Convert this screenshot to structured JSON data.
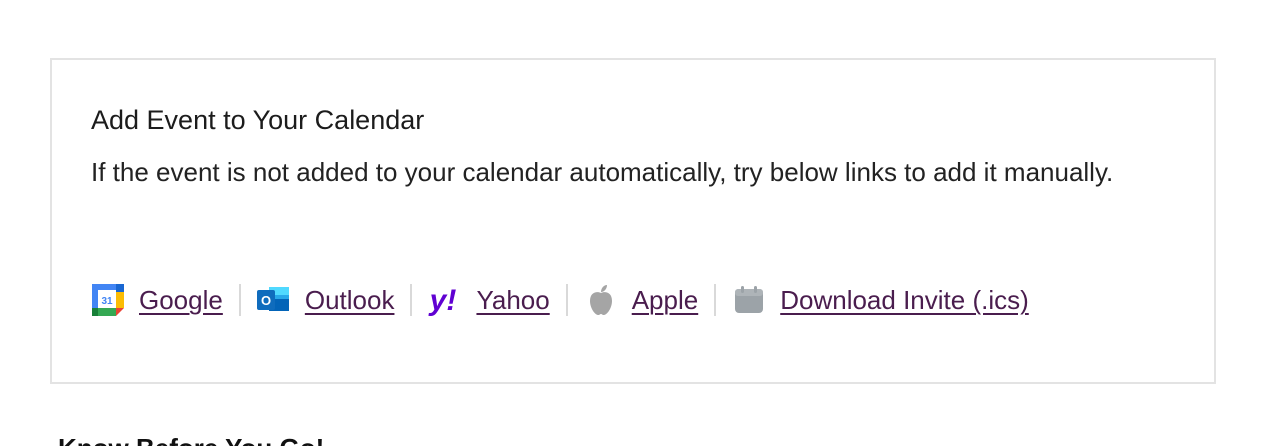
{
  "calendar": {
    "title": "Add Event to Your Calendar",
    "description": "If the event is not added to your calendar automatically, try below links to add it manually.",
    "links": [
      {
        "icon": "google-calendar-icon",
        "label": "Google",
        "icon_text": "31"
      },
      {
        "icon": "outlook-icon",
        "label": "Outlook",
        "icon_text": "O"
      },
      {
        "icon": "yahoo-icon",
        "label": "Yahoo",
        "icon_text": "y!"
      },
      {
        "icon": "apple-icon",
        "label": "Apple"
      },
      {
        "icon": "download-calendar-icon",
        "label": "Download Invite (.ics)"
      }
    ]
  },
  "next_section": {
    "heading": "Know Before You Go!"
  },
  "colors": {
    "link": "#4a1d4e",
    "separator": "#d9d9d9",
    "card_border": "#e3e3e3",
    "yahoo_purple": "#6001d2",
    "outlook_blue": "#0f6cbd",
    "apple_gray": "#a5a5a5"
  }
}
